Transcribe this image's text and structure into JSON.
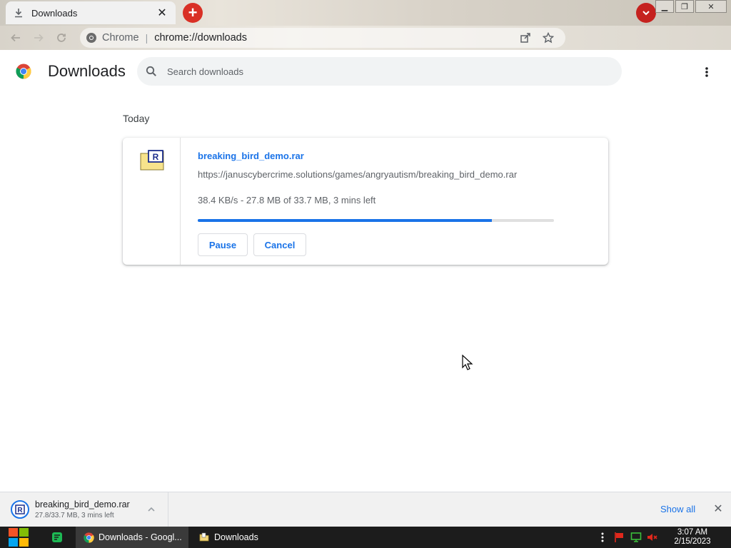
{
  "browser": {
    "tab": {
      "title": "Downloads",
      "icon": "download-icon"
    },
    "new_tab_icon": "plus-icon",
    "omnibox": {
      "site_label": "Chrome",
      "url": "chrome://downloads"
    }
  },
  "page": {
    "title": "Downloads",
    "search_placeholder": "Search downloads"
  },
  "downloads": {
    "section_label": "Today",
    "items": [
      {
        "file_name": "breaking_bird_demo.rar",
        "url": "https://januscybercrime.solutions/games/angryautism/breaking_bird_demo.rar",
        "status": "38.4 KB/s - 27.8 MB of 33.7 MB, 3 mins left",
        "progress_fraction": 0.825,
        "pause_label": "Pause",
        "cancel_label": "Cancel",
        "icon": "rar-archive-icon"
      }
    ]
  },
  "shelf": {
    "file_name": "breaking_bird_demo.rar",
    "status": "27.8/33.7 MB, 3 mins left",
    "show_all_label": "Show all"
  },
  "taskbar": {
    "tasks": [
      {
        "label": "Downloads - Googl...",
        "icon": "chrome-icon",
        "active": true
      },
      {
        "label": "Downloads",
        "icon": "folder-icon",
        "active": false
      }
    ],
    "clock": {
      "time": "3:07 AM",
      "date": "2/15/2023"
    }
  },
  "colors": {
    "accent": "#1a73e8",
    "progress_track": "#e0e0e0",
    "new_tab_button": "#d93025",
    "taskbar": "#1c1c1c"
  }
}
